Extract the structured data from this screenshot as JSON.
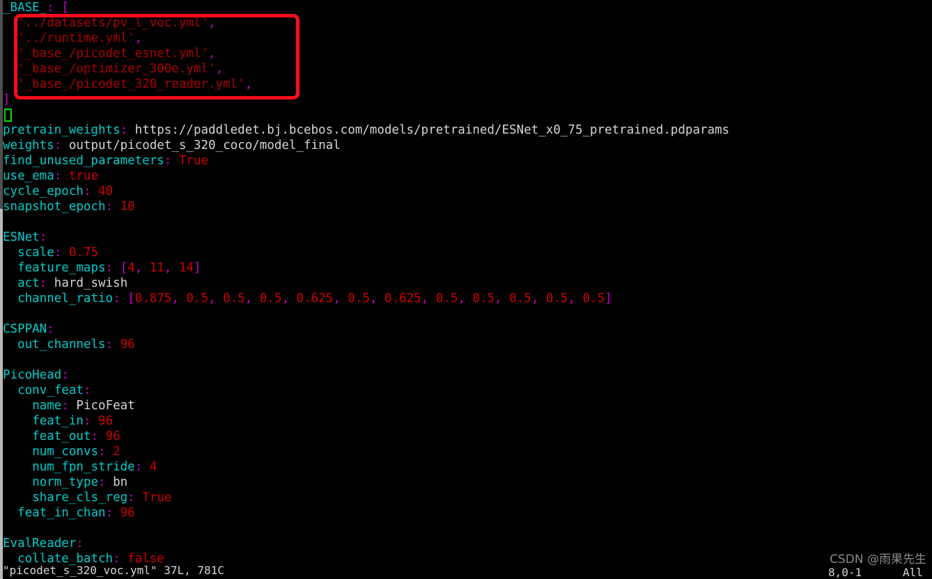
{
  "window": {
    "kind": "terminal-vim-editor",
    "background": "#000000",
    "colors": {
      "key_cyan": "#00cdcd",
      "punct_magenta": "#cd00cd",
      "number_red": "#cd0000",
      "string_darkred": "#aa0000",
      "plain_gray": "#d6d6d6",
      "annotation_red": "#fc0d1b",
      "cursor_green": "#00e000",
      "watermark_gray": "#8c8c8c"
    }
  },
  "editor": {
    "lines": [
      {
        "id": "l1",
        "indent": 0,
        "segments": [
          {
            "t": "_BASE_",
            "c": "key"
          },
          {
            "t": ":",
            "c": "punc"
          },
          {
            "t": " ",
            "c": "plain"
          },
          {
            "t": "[",
            "c": "punc"
          }
        ]
      },
      {
        "id": "l2",
        "indent": 2,
        "segments": [
          {
            "t": "'../datasets/pv_l_voc.yml'",
            "c": "str"
          },
          {
            "t": ",",
            "c": "punc"
          }
        ]
      },
      {
        "id": "l3",
        "indent": 2,
        "segments": [
          {
            "t": "'../runtime.yml'",
            "c": "str"
          },
          {
            "t": ",",
            "c": "punc"
          }
        ]
      },
      {
        "id": "l4",
        "indent": 2,
        "segments": [
          {
            "t": "'_base_/picodet_esnet.yml'",
            "c": "str"
          },
          {
            "t": ",",
            "c": "punc"
          }
        ]
      },
      {
        "id": "l5",
        "indent": 2,
        "segments": [
          {
            "t": "'_base_/optimizer_300e.yml'",
            "c": "str"
          },
          {
            "t": ",",
            "c": "punc"
          }
        ]
      },
      {
        "id": "l6",
        "indent": 2,
        "segments": [
          {
            "t": "'_base_/picodet_320_reader.yml'",
            "c": "str"
          },
          {
            "t": ",",
            "c": "punc"
          }
        ]
      },
      {
        "id": "l7",
        "indent": 0,
        "segments": [
          {
            "t": "]",
            "c": "punc"
          }
        ]
      },
      {
        "id": "l8",
        "indent": 0,
        "segments": []
      },
      {
        "id": "l9",
        "indent": 0,
        "segments": [
          {
            "t": "pretrain_weights",
            "c": "key"
          },
          {
            "t": ":",
            "c": "punc"
          },
          {
            "t": " https://paddledet.bj.bcebos.com/models/pretrained/ESNet_x0_75_pretrained.pdparams",
            "c": "plain"
          }
        ]
      },
      {
        "id": "l10",
        "indent": 0,
        "segments": [
          {
            "t": "weights",
            "c": "key"
          },
          {
            "t": ":",
            "c": "punc"
          },
          {
            "t": " output/picodet_s_320_coco/model_final",
            "c": "plain"
          }
        ]
      },
      {
        "id": "l11",
        "indent": 0,
        "segments": [
          {
            "t": "find_unused_parameters",
            "c": "key"
          },
          {
            "t": ":",
            "c": "punc"
          },
          {
            "t": " ",
            "c": "plain"
          },
          {
            "t": "True",
            "c": "bool"
          }
        ]
      },
      {
        "id": "l12",
        "indent": 0,
        "segments": [
          {
            "t": "use_ema",
            "c": "key"
          },
          {
            "t": ":",
            "c": "punc"
          },
          {
            "t": " ",
            "c": "plain"
          },
          {
            "t": "true",
            "c": "bool"
          }
        ]
      },
      {
        "id": "l13",
        "indent": 0,
        "segments": [
          {
            "t": "cycle_epoch",
            "c": "key"
          },
          {
            "t": ":",
            "c": "punc"
          },
          {
            "t": " ",
            "c": "plain"
          },
          {
            "t": "40",
            "c": "num"
          }
        ]
      },
      {
        "id": "l14",
        "indent": 0,
        "segments": [
          {
            "t": "snapshot_epoch",
            "c": "key"
          },
          {
            "t": ":",
            "c": "punc"
          },
          {
            "t": " ",
            "c": "plain"
          },
          {
            "t": "10",
            "c": "num"
          }
        ]
      },
      {
        "id": "l15",
        "indent": 0,
        "segments": []
      },
      {
        "id": "l16",
        "indent": 0,
        "segments": [
          {
            "t": "ESNet",
            "c": "key"
          },
          {
            "t": ":",
            "c": "punc"
          }
        ]
      },
      {
        "id": "l17",
        "indent": 2,
        "segments": [
          {
            "t": "scale",
            "c": "key"
          },
          {
            "t": ":",
            "c": "punc"
          },
          {
            "t": " ",
            "c": "plain"
          },
          {
            "t": "0.75",
            "c": "num"
          }
        ]
      },
      {
        "id": "l18",
        "indent": 2,
        "segments": [
          {
            "t": "feature_maps",
            "c": "key"
          },
          {
            "t": ":",
            "c": "punc"
          },
          {
            "t": " ",
            "c": "plain"
          },
          {
            "t": "[",
            "c": "punc"
          },
          {
            "t": "4",
            "c": "num"
          },
          {
            "t": ", ",
            "c": "punc"
          },
          {
            "t": "11",
            "c": "num"
          },
          {
            "t": ", ",
            "c": "punc"
          },
          {
            "t": "14",
            "c": "num"
          },
          {
            "t": "]",
            "c": "punc"
          }
        ]
      },
      {
        "id": "l19",
        "indent": 2,
        "segments": [
          {
            "t": "act",
            "c": "key"
          },
          {
            "t": ":",
            "c": "punc"
          },
          {
            "t": " hard_swish",
            "c": "plain"
          }
        ]
      },
      {
        "id": "l20",
        "indent": 2,
        "segments": [
          {
            "t": "channel_ratio",
            "c": "key"
          },
          {
            "t": ":",
            "c": "punc"
          },
          {
            "t": " ",
            "c": "plain"
          },
          {
            "t": "[",
            "c": "punc"
          },
          {
            "t": "0.875",
            "c": "num"
          },
          {
            "t": ", ",
            "c": "punc"
          },
          {
            "t": "0.5",
            "c": "num"
          },
          {
            "t": ", ",
            "c": "punc"
          },
          {
            "t": "0.5",
            "c": "num"
          },
          {
            "t": ", ",
            "c": "punc"
          },
          {
            "t": "0.5",
            "c": "num"
          },
          {
            "t": ", ",
            "c": "punc"
          },
          {
            "t": "0.625",
            "c": "num"
          },
          {
            "t": ", ",
            "c": "punc"
          },
          {
            "t": "0.5",
            "c": "num"
          },
          {
            "t": ", ",
            "c": "punc"
          },
          {
            "t": "0.625",
            "c": "num"
          },
          {
            "t": ", ",
            "c": "punc"
          },
          {
            "t": "0.5",
            "c": "num"
          },
          {
            "t": ", ",
            "c": "punc"
          },
          {
            "t": "0.5",
            "c": "num"
          },
          {
            "t": ", ",
            "c": "punc"
          },
          {
            "t": "0.5",
            "c": "num"
          },
          {
            "t": ", ",
            "c": "punc"
          },
          {
            "t": "0.5",
            "c": "num"
          },
          {
            "t": ", ",
            "c": "punc"
          },
          {
            "t": "0.5",
            "c": "num"
          },
          {
            "t": "]",
            "c": "punc"
          }
        ]
      },
      {
        "id": "l21",
        "indent": 0,
        "segments": []
      },
      {
        "id": "l22",
        "indent": 0,
        "segments": [
          {
            "t": "CSPPAN",
            "c": "key"
          },
          {
            "t": ":",
            "c": "punc"
          }
        ]
      },
      {
        "id": "l23",
        "indent": 2,
        "segments": [
          {
            "t": "out_channels",
            "c": "key"
          },
          {
            "t": ":",
            "c": "punc"
          },
          {
            "t": " ",
            "c": "plain"
          },
          {
            "t": "96",
            "c": "num"
          }
        ]
      },
      {
        "id": "l24",
        "indent": 0,
        "segments": []
      },
      {
        "id": "l25",
        "indent": 0,
        "segments": [
          {
            "t": "PicoHead",
            "c": "key"
          },
          {
            "t": ":",
            "c": "punc"
          }
        ]
      },
      {
        "id": "l26",
        "indent": 2,
        "segments": [
          {
            "t": "conv_feat",
            "c": "key"
          },
          {
            "t": ":",
            "c": "punc"
          }
        ]
      },
      {
        "id": "l27",
        "indent": 4,
        "segments": [
          {
            "t": "name",
            "c": "key"
          },
          {
            "t": ":",
            "c": "punc"
          },
          {
            "t": " PicoFeat",
            "c": "plain"
          }
        ]
      },
      {
        "id": "l28",
        "indent": 4,
        "segments": [
          {
            "t": "feat_in",
            "c": "key"
          },
          {
            "t": ":",
            "c": "punc"
          },
          {
            "t": " ",
            "c": "plain"
          },
          {
            "t": "96",
            "c": "num"
          }
        ]
      },
      {
        "id": "l29",
        "indent": 4,
        "segments": [
          {
            "t": "feat_out",
            "c": "key"
          },
          {
            "t": ":",
            "c": "punc"
          },
          {
            "t": " ",
            "c": "plain"
          },
          {
            "t": "96",
            "c": "num"
          }
        ]
      },
      {
        "id": "l30",
        "indent": 4,
        "segments": [
          {
            "t": "num_convs",
            "c": "key"
          },
          {
            "t": ":",
            "c": "punc"
          },
          {
            "t": " ",
            "c": "plain"
          },
          {
            "t": "2",
            "c": "num"
          }
        ]
      },
      {
        "id": "l31",
        "indent": 4,
        "segments": [
          {
            "t": "num_fpn_stride",
            "c": "key"
          },
          {
            "t": ":",
            "c": "punc"
          },
          {
            "t": " ",
            "c": "plain"
          },
          {
            "t": "4",
            "c": "num"
          }
        ]
      },
      {
        "id": "l32",
        "indent": 4,
        "segments": [
          {
            "t": "norm_type",
            "c": "key"
          },
          {
            "t": ":",
            "c": "punc"
          },
          {
            "t": " bn",
            "c": "plain"
          }
        ]
      },
      {
        "id": "l33",
        "indent": 4,
        "segments": [
          {
            "t": "share_cls_reg",
            "c": "key"
          },
          {
            "t": ":",
            "c": "punc"
          },
          {
            "t": " ",
            "c": "plain"
          },
          {
            "t": "True",
            "c": "bool"
          }
        ]
      },
      {
        "id": "l34",
        "indent": 2,
        "segments": [
          {
            "t": "feat_in_chan",
            "c": "key"
          },
          {
            "t": ":",
            "c": "punc"
          },
          {
            "t": " ",
            "c": "plain"
          },
          {
            "t": "96",
            "c": "num"
          }
        ]
      },
      {
        "id": "l35",
        "indent": 0,
        "segments": []
      },
      {
        "id": "l36",
        "indent": 0,
        "segments": [
          {
            "t": "EvalReader",
            "c": "key"
          },
          {
            "t": ":",
            "c": "punc"
          }
        ]
      },
      {
        "id": "l37",
        "indent": 2,
        "segments": [
          {
            "t": "collate_batch",
            "c": "key"
          },
          {
            "t": ":",
            "c": "punc"
          },
          {
            "t": " ",
            "c": "plain"
          },
          {
            "t": "false",
            "c": "bool"
          }
        ]
      }
    ]
  },
  "status_line": {
    "file_info": "\"picodet_s_320_voc.yml\" 37L, 781C",
    "cursor_position": "8,0-1",
    "scroll_indicator": "All"
  },
  "annotation": {
    "type": "red-rectangle-highlight",
    "covers": "_BASE_ include list"
  },
  "watermark": {
    "text": "CSDN @雨果先生"
  }
}
